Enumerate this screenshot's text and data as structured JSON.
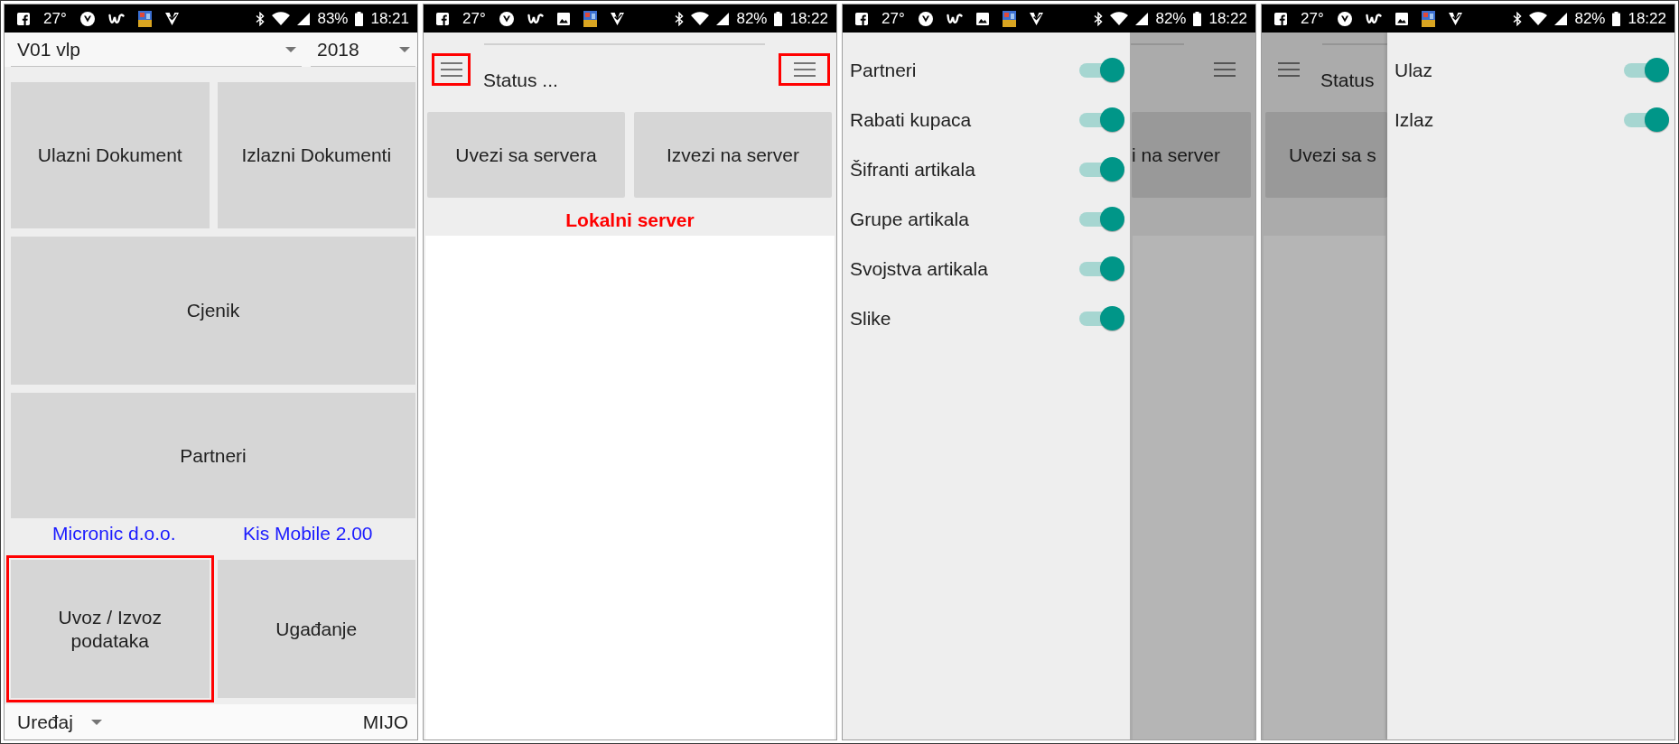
{
  "screens": [
    {
      "kind": "home",
      "status_bar": {
        "notifications": [
          {
            "kind": "facebook"
          },
          {
            "kind": "text",
            "text": "27°"
          },
          {
            "kind": "emblem"
          },
          {
            "kind": "squiggle"
          },
          {
            "kind": "app"
          },
          {
            "kind": "check"
          }
        ],
        "battery": "83%",
        "time": "18:21"
      },
      "pickers": [
        {
          "value": "V01 vlp"
        },
        {
          "value": "2018"
        }
      ],
      "tile_rows": [
        {
          "tiles": [
            {
              "label": "Ulazni Dokument",
              "highlighted": false
            },
            {
              "label": "Izlazni Dokumenti",
              "highlighted": false
            }
          ]
        },
        {
          "tiles": [
            {
              "label": "Cjenik",
              "highlighted": false
            }
          ]
        },
        {
          "tiles": [
            {
              "label": "Partneri",
              "highlighted": false
            }
          ]
        }
      ],
      "info": [
        "Micronic d.o.o.",
        "Kis Mobile 2.00"
      ],
      "bottom_tiles": [
        {
          "label": "Uvoz / Izvoz podataka",
          "highlighted": true
        },
        {
          "label": "Ugađanje",
          "highlighted": false
        }
      ],
      "footer": {
        "picker": {
          "value": "Uređaj"
        },
        "user": "MIJO"
      }
    },
    {
      "kind": "sync",
      "status_bar": {
        "notifications": [
          {
            "kind": "facebook"
          },
          {
            "kind": "text",
            "text": "27°"
          },
          {
            "kind": "emblem"
          },
          {
            "kind": "squiggle"
          },
          {
            "kind": "image"
          },
          {
            "kind": "app"
          },
          {
            "kind": "check"
          }
        ],
        "battery": "82%",
        "time": "18:22"
      },
      "header": {
        "left_menu": {
          "highlighted": true
        },
        "status": "Status ...",
        "right_menu": {
          "highlighted": true
        }
      },
      "actions": [
        "Uvezi sa servera",
        "Izvezi na server"
      ],
      "server": "Lokalni server"
    },
    {
      "kind": "left_drawer",
      "status_bar": {
        "notifications": [
          {
            "kind": "facebook"
          },
          {
            "kind": "text",
            "text": "27°"
          },
          {
            "kind": "emblem"
          },
          {
            "kind": "squiggle"
          },
          {
            "kind": "image"
          },
          {
            "kind": "app"
          },
          {
            "kind": "check"
          }
        ],
        "battery": "82%",
        "time": "18:22"
      },
      "drawer": {
        "items": [
          {
            "label": "Partneri",
            "on": true
          },
          {
            "label": "Rabati kupaca",
            "on": true
          },
          {
            "label": "Šifranti artikala",
            "on": true
          },
          {
            "label": "Grupe artikala",
            "on": true
          },
          {
            "label": "Svojstva artikala",
            "on": true
          },
          {
            "label": "Slike",
            "on": true
          }
        ]
      },
      "behind": {
        "action": "i na server"
      }
    },
    {
      "kind": "right_drawer",
      "status_bar": {
        "notifications": [
          {
            "kind": "facebook"
          },
          {
            "kind": "text",
            "text": "27°"
          },
          {
            "kind": "emblem"
          },
          {
            "kind": "squiggle"
          },
          {
            "kind": "image"
          },
          {
            "kind": "app"
          },
          {
            "kind": "check"
          }
        ],
        "battery": "82%",
        "time": "18:22"
      },
      "drawer": {
        "items": [
          {
            "label": "Ulaz",
            "on": true
          },
          {
            "label": "Izlaz",
            "on": true
          }
        ]
      },
      "behind": {
        "status": "Status",
        "action": "Uvezi sa s"
      }
    }
  ]
}
